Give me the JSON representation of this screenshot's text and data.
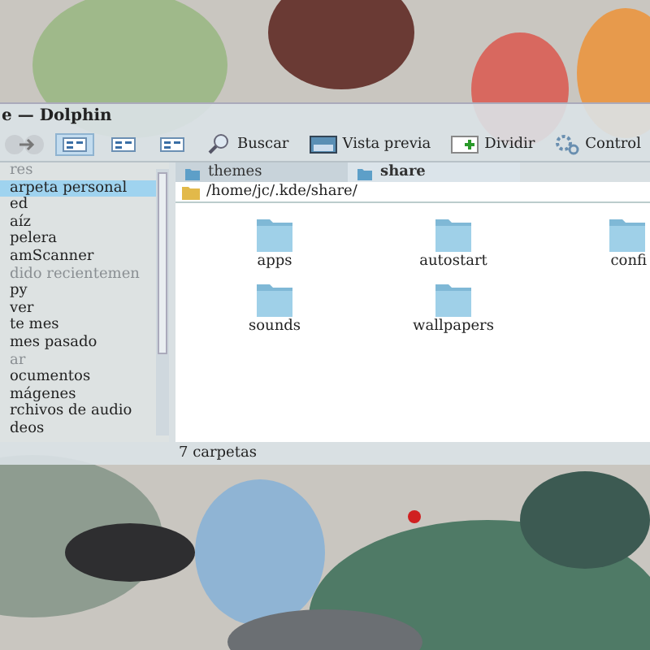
{
  "window": {
    "title": "e — Dolphin"
  },
  "toolbar": {
    "views": [
      {
        "selected": true
      },
      {
        "selected": false
      },
      {
        "selected": false
      }
    ],
    "actions": [
      {
        "label": "Buscar",
        "kind": "search"
      },
      {
        "label": "Vista previa",
        "kind": "preview"
      },
      {
        "label": "Dividir",
        "kind": "split"
      },
      {
        "label": "Control",
        "kind": "control"
      }
    ]
  },
  "sidebar": {
    "items": [
      {
        "label": "res",
        "kind": "header",
        "selected": false
      },
      {
        "label": "arpeta personal",
        "kind": "place",
        "selected": true
      },
      {
        "label": "ed",
        "kind": "place",
        "selected": false
      },
      {
        "label": "aíz",
        "kind": "place",
        "selected": false
      },
      {
        "label": "pelera",
        "kind": "place",
        "selected": false
      },
      {
        "label": "amScanner",
        "kind": "place",
        "selected": false
      },
      {
        "label": "dido recientemen",
        "kind": "header",
        "selected": false
      },
      {
        "label": "py",
        "kind": "place",
        "selected": false
      },
      {
        "label": "ver",
        "kind": "place",
        "selected": false
      },
      {
        "label": "te mes",
        "kind": "place",
        "selected": false
      },
      {
        "label": "mes pasado",
        "kind": "place",
        "selected": false
      },
      {
        "label": "ar",
        "kind": "header",
        "selected": false
      },
      {
        "label": "ocumentos",
        "kind": "place",
        "selected": false
      },
      {
        "label": "mágenes",
        "kind": "place",
        "selected": false
      },
      {
        "label": "rchivos de audio",
        "kind": "place",
        "selected": false
      },
      {
        "label": "deos",
        "kind": "place",
        "selected": false
      }
    ]
  },
  "tabs": [
    {
      "label": "themes",
      "selected": false
    },
    {
      "label": "share",
      "selected": true
    }
  ],
  "location": {
    "path": "/home/jc/.kde/share/"
  },
  "files": [
    {
      "name": "apps"
    },
    {
      "name": "autostart"
    },
    {
      "name": "confi"
    },
    {
      "name": "sounds"
    },
    {
      "name": "wallpapers"
    }
  ],
  "status_bar": {
    "text": "7 carpetas"
  }
}
